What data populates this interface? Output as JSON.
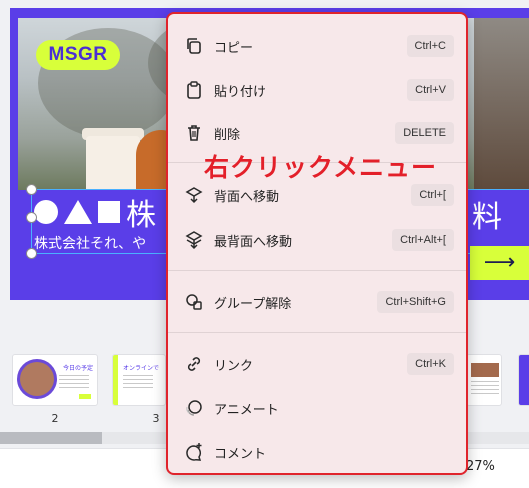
{
  "slide": {
    "logo": "MSGR",
    "title_shapes": "●▲■",
    "title_char": "株",
    "title_right": "料",
    "subtitle": "株式会社それ、や",
    "next_arrow": "⟶"
  },
  "thumbnails": [
    {
      "number": "2",
      "heading": "今日の予定"
    },
    {
      "number": "3",
      "heading": "オンラインで"
    }
  ],
  "zoom": "27%",
  "context_menu": {
    "annotation": "右クリックメニュー",
    "items": [
      {
        "label": "コピー",
        "shortcut": "Ctrl+C",
        "icon": "copy-icon"
      },
      {
        "label": "貼り付け",
        "shortcut": "Ctrl+V",
        "icon": "clipboard-icon"
      },
      {
        "label": "削除",
        "shortcut": "DELETE",
        "icon": "trash-icon"
      },
      {
        "label": "背面へ移動",
        "shortcut": "Ctrl+[",
        "icon": "send-backward-icon"
      },
      {
        "label": "最背面へ移動",
        "shortcut": "Ctrl+Alt+[",
        "icon": "send-to-back-icon"
      },
      {
        "label": "グループ解除",
        "shortcut": "Ctrl+Shift+G",
        "icon": "ungroup-icon"
      },
      {
        "label": "リンク",
        "shortcut": "Ctrl+K",
        "icon": "link-icon"
      },
      {
        "label": "アニメート",
        "shortcut": "",
        "icon": "animate-icon"
      },
      {
        "label": "コメント",
        "shortcut": "",
        "icon": "comment-add-icon"
      }
    ]
  },
  "colors": {
    "slide_bg": "#5a3ee8",
    "accent_lime": "#d8ff3a",
    "menu_border": "#e0242c",
    "menu_bg": "#f7e8ea",
    "selection": "#4ab0ff"
  }
}
